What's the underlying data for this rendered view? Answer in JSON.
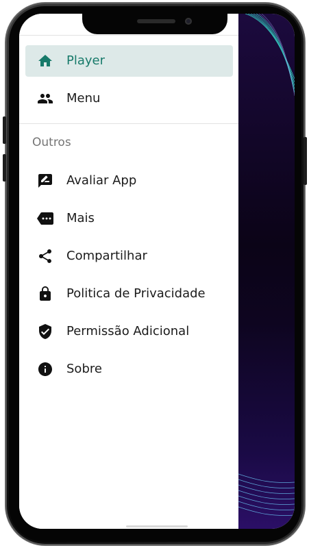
{
  "drawer": {
    "primary_items": [
      {
        "label": "Player",
        "icon": "home-icon",
        "active": true
      },
      {
        "label": "Menu",
        "icon": "people-icon",
        "active": false
      }
    ],
    "section_title": "Outros",
    "other_items": [
      {
        "label": "Avaliar App",
        "icon": "rate-review-icon"
      },
      {
        "label": "Mais",
        "icon": "more-label-icon"
      },
      {
        "label": "Compartilhar",
        "icon": "share-icon"
      },
      {
        "label": "Politica de Privacidade",
        "icon": "lock-icon"
      },
      {
        "label": "Permissão Adicional",
        "icon": "verified-shield-icon"
      },
      {
        "label": "Sobre",
        "icon": "info-icon"
      }
    ]
  },
  "colors": {
    "accent": "#177a6a",
    "active_bg": "#dde9e8",
    "icon": "#111111",
    "app_bg": "#120628"
  }
}
